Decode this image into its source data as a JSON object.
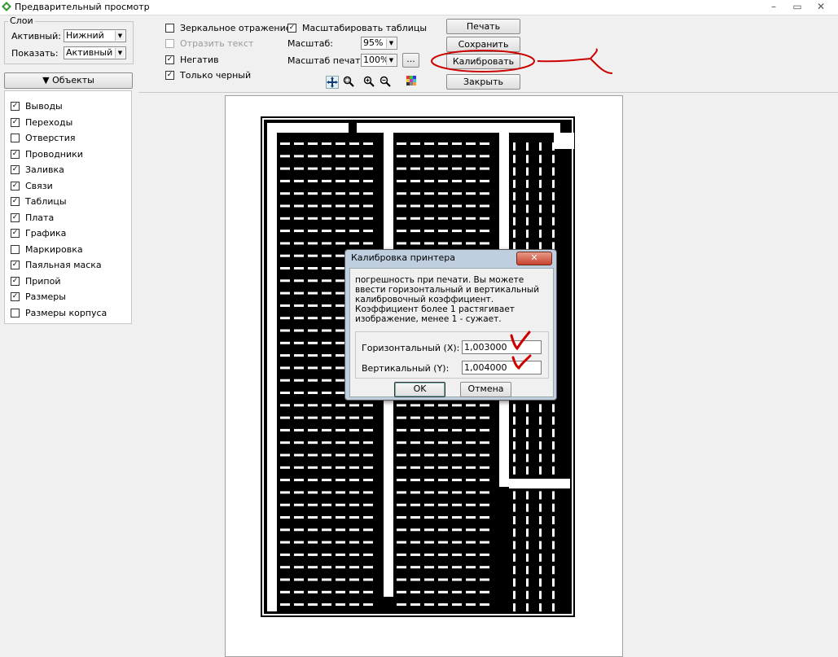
{
  "window": {
    "title": "Предварительный просмотр",
    "controls": [
      "–",
      "▭",
      "✕"
    ]
  },
  "layers": {
    "group_title": "Слои",
    "active_label": "Активный:",
    "active_value": "Нижний",
    "show_label": "Показать:",
    "show_value": "Активный"
  },
  "objects": {
    "button_label": "▼ Объекты",
    "items": [
      {
        "label": "Выводы",
        "checked": true
      },
      {
        "label": "Переходы",
        "checked": true
      },
      {
        "label": "Отверстия",
        "checked": false
      },
      {
        "label": "Проводники",
        "checked": true
      },
      {
        "label": "Заливка",
        "checked": true
      },
      {
        "label": "Связи",
        "checked": true
      },
      {
        "label": "Таблицы",
        "checked": true
      },
      {
        "label": "Плата",
        "checked": true
      },
      {
        "label": "Графика",
        "checked": true
      },
      {
        "label": "Маркировка",
        "checked": false
      },
      {
        "label": "Паяльная маска",
        "checked": true
      },
      {
        "label": "Припой",
        "checked": true
      },
      {
        "label": "Размеры",
        "checked": true
      },
      {
        "label": "Размеры корпуса",
        "checked": false
      }
    ]
  },
  "options": {
    "mirror": {
      "label": "Зеркальное отражение",
      "checked": false
    },
    "flip_text": {
      "label": "Отразить текст",
      "checked": false,
      "disabled": true
    },
    "negative": {
      "label": "Негатив",
      "checked": true
    },
    "black_only": {
      "label": "Только черный",
      "checked": true
    },
    "scale_tables": {
      "label": "Масштабировать таблицы",
      "checked": true
    }
  },
  "scale": {
    "label": "Масштаб:",
    "value": "95%",
    "print_label": "Масштаб печати:",
    "print_value": "100%",
    "more_button": "..."
  },
  "buttons": {
    "print": "Печать",
    "save": "Сохранить",
    "calibrate": "Калибровать",
    "close": "Закрыть"
  },
  "tools": [
    "move-icon",
    "zoom-area-icon",
    "zoom-in-icon",
    "zoom-out-icon",
    "color-palette-icon"
  ],
  "dialog": {
    "title": "Калибровка принтера",
    "close_label": "✕",
    "text": "погрешность при печати. Вы можете ввести горизонтальный и вертикальный калибровочный коэффициент. Коэффициент более 1 растягивает изображение, менее 1 - сужает.",
    "horizontal_label": "Горизонтальный (X):",
    "horizontal_value": "1,003000",
    "vertical_label": "Вертикальный (Y):",
    "vertical_value": "1,004000",
    "ok": "OK",
    "cancel": "Отмена"
  },
  "colors": {
    "annotation": "#cc0000",
    "dialog_frame": "#bfcfe0",
    "board": "#000000"
  }
}
